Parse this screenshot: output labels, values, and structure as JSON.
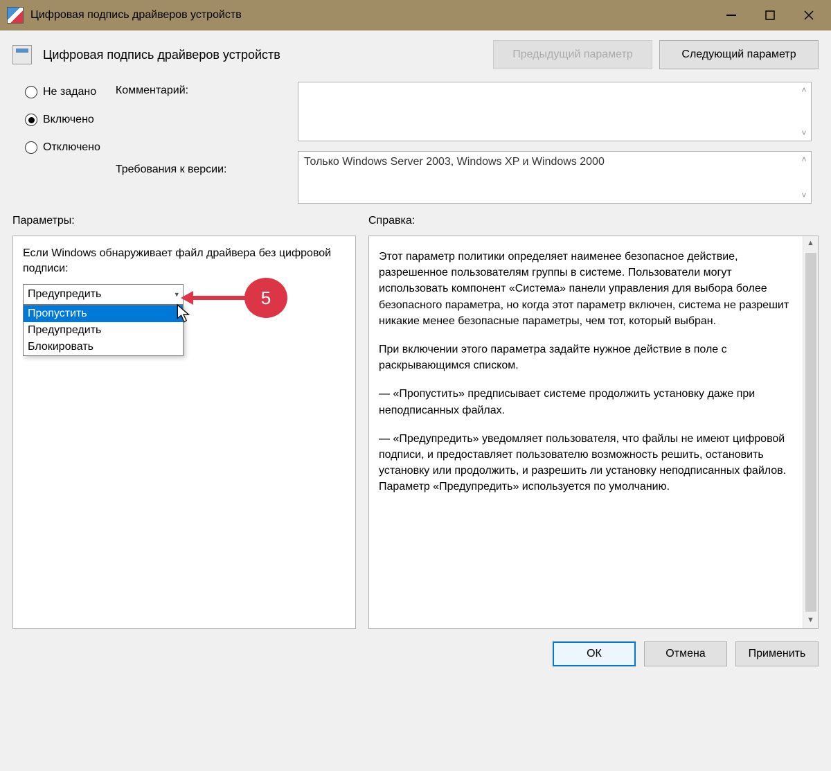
{
  "titlebar": {
    "title": "Цифровая подпись драйверов устройств"
  },
  "nav": {
    "title": "Цифровая подпись драйверов устройств",
    "prev": "Предыдущий параметр",
    "next": "Следующий параметр"
  },
  "radios": {
    "not_set": "Не задано",
    "enabled": "Включено",
    "disabled": "Отключено",
    "selected": "enabled"
  },
  "fields": {
    "comment_label": "Комментарий:",
    "comment_value": "",
    "version_label": "Требования к версии:",
    "version_value": "Только Windows Server 2003, Windows XP и Windows 2000"
  },
  "sections": {
    "options": "Параметры:",
    "help": "Справка:"
  },
  "options_panel": {
    "intro": "Если Windows обнаруживает файл драйвера без цифровой подписи:",
    "selected": "Предупредить",
    "items": [
      "Пропустить",
      "Предупредить",
      "Блокировать"
    ],
    "highlighted": 0
  },
  "callout": {
    "num": "5"
  },
  "help_panel": {
    "p1": "Этот параметр политики определяет наименее безопасное действие, разрешенное пользователям группы в системе. Пользователи могут использовать компонент «Система» панели управления для выбора более безопасного параметра, но когда этот параметр включен, система не разрешит никакие менее безопасные параметры, чем тот, который выбран.",
    "p2": "При включении этого параметра задайте нужное действие в поле с раскрывающимся списком.",
    "p3": "— «Пропустить» предписывает системе продолжить установку даже при неподписанных файлах.",
    "p4": "— «Предупредить» уведомляет пользователя, что файлы не имеют цифровой подписи, и предоставляет пользователю возможность решить, остановить установку или продолжить, и разрешить ли установку неподписанных файлов. Параметр «Предупредить» используется по умолчанию."
  },
  "footer": {
    "ok": "ОК",
    "cancel": "Отмена",
    "apply": "Применить"
  }
}
